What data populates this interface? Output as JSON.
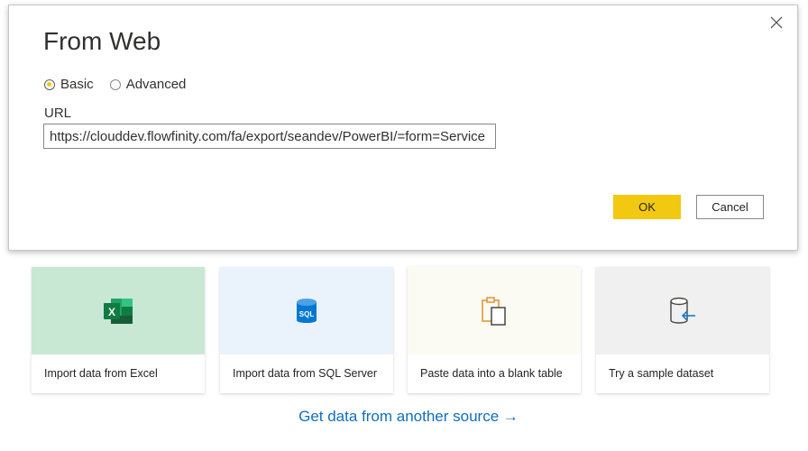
{
  "dialog": {
    "title": "From Web",
    "radio_basic": "Basic",
    "radio_advanced": "Advanced",
    "selected_mode": "Basic",
    "url_label": "URL",
    "url_value": "https://clouddev.flowfinity.com/fa/export/seandev/PowerBI/=form=Service",
    "ok_label": "OK",
    "cancel_label": "Cancel"
  },
  "cards": [
    {
      "label": "Import data from Excel",
      "icon": "excel-icon",
      "bg": "#c8e8d4"
    },
    {
      "label": "Import data from SQL Server",
      "icon": "sql-database-icon",
      "bg": "#eaf3fb"
    },
    {
      "label": "Paste data into a blank table",
      "icon": "paste-clipboard-icon",
      "bg": "#fcfbf3"
    },
    {
      "label": "Try a sample dataset",
      "icon": "sample-dataset-icon",
      "bg": "#f0f0f0"
    }
  ],
  "get_data_link": "Get data from another source →",
  "colors": {
    "accent": "#f2c811",
    "link": "#106ebe"
  }
}
